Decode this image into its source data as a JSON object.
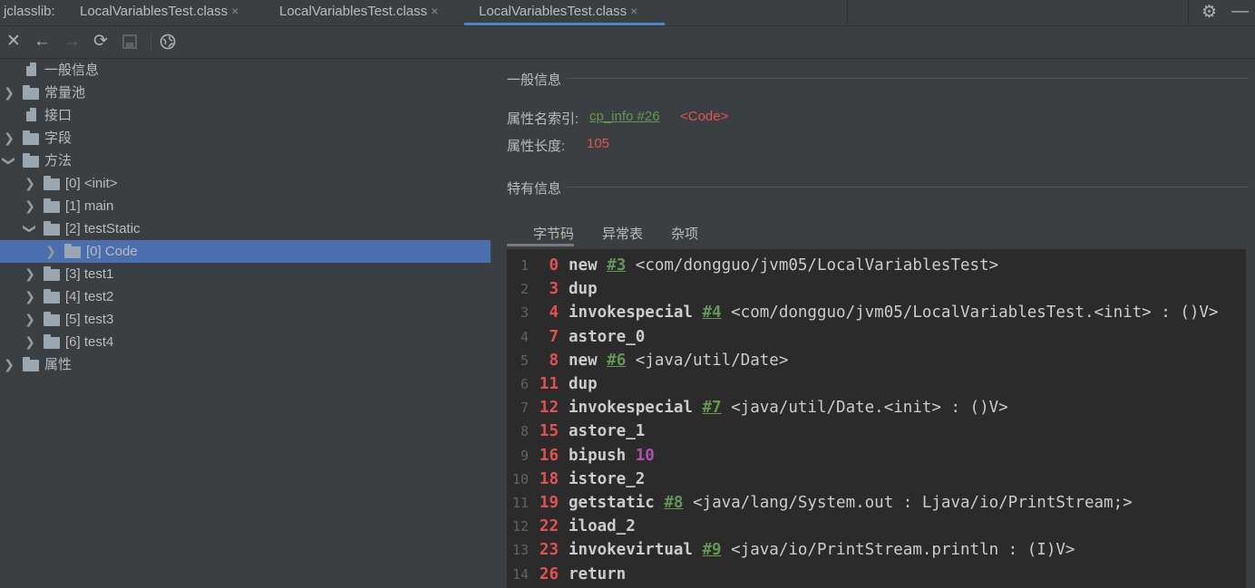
{
  "tabbar": {
    "plugin_label": "jclasslib:",
    "tabs": [
      {
        "label": "LocalVariablesTest.class"
      },
      {
        "label": "LocalVariablesTest.class"
      },
      {
        "label": "LocalVariablesTest.class"
      }
    ],
    "close_glyph": "×"
  },
  "toolbar": {
    "icons": [
      "close-icon",
      "back-icon",
      "forward-icon",
      "refresh-icon",
      "save-icon",
      "web-icon"
    ]
  },
  "tree": {
    "nodes": [
      {
        "label": "一般信息",
        "kind": "file"
      },
      {
        "label": "常量池",
        "kind": "folder",
        "expanded": false
      },
      {
        "label": "接口",
        "kind": "file"
      },
      {
        "label": "字段",
        "kind": "folder",
        "expanded": false
      },
      {
        "label": "方法",
        "kind": "folder",
        "expanded": true
      },
      {
        "label": "[0] <init>",
        "kind": "folder",
        "expanded": false
      },
      {
        "label": "[1] main",
        "kind": "folder",
        "expanded": false
      },
      {
        "label": "[2] testStatic",
        "kind": "folder",
        "expanded": true
      },
      {
        "label": "[0] Code",
        "kind": "folder",
        "expanded": false,
        "selected": true
      },
      {
        "label": "[3] test1",
        "kind": "folder",
        "expanded": false
      },
      {
        "label": "[4] test2",
        "kind": "folder",
        "expanded": false
      },
      {
        "label": "[5] test3",
        "kind": "folder",
        "expanded": false
      },
      {
        "label": "[6] test4",
        "kind": "folder",
        "expanded": false
      },
      {
        "label": "属性",
        "kind": "folder",
        "expanded": false
      }
    ]
  },
  "detail": {
    "general_title": "一般信息",
    "attr_name_label": "属性名索引:",
    "attr_name_ref": "cp_info #26",
    "attr_name_value": "<Code>",
    "attr_len_label": "属性长度:",
    "attr_len_value": "105",
    "specific_title": "特有信息",
    "subtabs": [
      "字节码",
      "异常表",
      "杂项"
    ]
  },
  "bytecode": [
    {
      "line": "1",
      "offset": "0",
      "op": "new",
      "ref": "#3",
      "arg": "<com/dongguo/jvm05/LocalVariablesTest>"
    },
    {
      "line": "2",
      "offset": "3",
      "op": "dup"
    },
    {
      "line": "3",
      "offset": "4",
      "op": "invokespecial",
      "ref": "#4",
      "arg": "<com/dongguo/jvm05/LocalVariablesTest.<init> : ()V>"
    },
    {
      "line": "4",
      "offset": "7",
      "op": "astore_0"
    },
    {
      "line": "5",
      "offset": "8",
      "op": "new",
      "ref": "#6",
      "arg": "<java/util/Date>"
    },
    {
      "line": "6",
      "offset": "11",
      "op": "dup"
    },
    {
      "line": "7",
      "offset": "12",
      "op": "invokespecial",
      "ref": "#7",
      "arg": "<java/util/Date.<init> : ()V>"
    },
    {
      "line": "8",
      "offset": "15",
      "op": "astore_1"
    },
    {
      "line": "9",
      "offset": "16",
      "op": "bipush",
      "num": "10"
    },
    {
      "line": "10",
      "offset": "18",
      "op": "istore_2"
    },
    {
      "line": "11",
      "offset": "19",
      "op": "getstatic",
      "ref": "#8",
      "arg": "<java/lang/System.out : Ljava/io/PrintStream;>"
    },
    {
      "line": "12",
      "offset": "22",
      "op": "iload_2"
    },
    {
      "line": "13",
      "offset": "23",
      "op": "invokevirtual",
      "ref": "#9",
      "arg": "<java/io/PrintStream.println : (I)V>"
    },
    {
      "line": "14",
      "offset": "26",
      "op": "return"
    }
  ],
  "colors": {
    "selection": "#4b6eaf",
    "offset_red": "#e35252",
    "ref_green": "#629755",
    "number_purple": "#b151b1",
    "accent_blue": "#4a88c7"
  }
}
